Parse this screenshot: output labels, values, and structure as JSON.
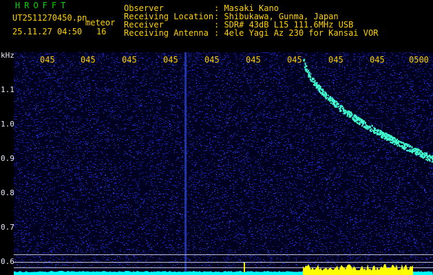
{
  "header": {
    "system": "HROFFT",
    "filename": "UT2511270450.pn",
    "event_type": "meteor",
    "datetime": "25.11.27 04:50",
    "count": "16",
    "fields": [
      {
        "label": "Observer",
        "value": ": Masaki Kano"
      },
      {
        "label": "Receiving Location",
        "value": ": Shibukawa, Gunma, Japan"
      },
      {
        "label": "Receiver",
        "value": ": SDR# 43dB L15 111.6MHz USB"
      },
      {
        "label": "Receiving Antenna",
        "value": ": 4ele Yagi Az 230 for Kansai VOR"
      }
    ]
  },
  "spectrogram": {
    "y_unit": "kHz",
    "y_ticks": [
      "1.1",
      "1.0",
      "0.9",
      "0.8",
      "0.7",
      "0.6"
    ],
    "x_ticks": [
      "045",
      "045",
      "045",
      "045",
      "045",
      "045",
      "045",
      "045",
      "045",
      "0500"
    ],
    "colors": {
      "background": "#000020",
      "noise": "#1020a0",
      "signal": "#40ffd0",
      "baseline": "#00ffff",
      "burst": "#ffff00"
    }
  }
}
